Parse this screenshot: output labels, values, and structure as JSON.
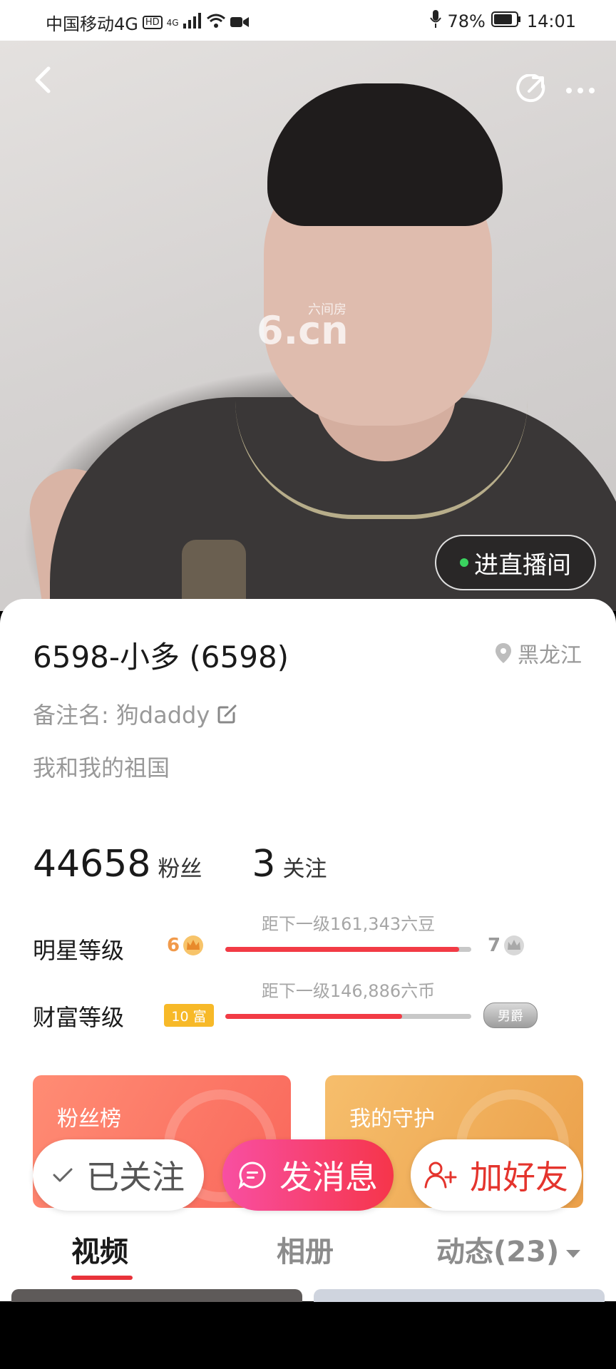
{
  "status_bar": {
    "carrier": "中国移动4G",
    "hd_badge": "HD",
    "net": "4G",
    "battery": "78%",
    "time": "14:01"
  },
  "header": {
    "back_icon": "back-arrow-icon",
    "share_icon": "share-icon",
    "more_icon": "more-dots-icon"
  },
  "hero": {
    "watermark_text": "6.cn",
    "watermark_small": "六间房",
    "live_button": "进直播间"
  },
  "profile": {
    "name": "6598-小多 (6598)",
    "location": "黑龙江",
    "remark_label": "备注名:",
    "remark_value": "狗daddy",
    "signature": "我和我的祖国"
  },
  "stats": {
    "fans_count": "44658",
    "fans_label": "粉丝",
    "following_count": "3",
    "following_label": "关注"
  },
  "levels": {
    "star": {
      "title": "明星等级",
      "current": "6",
      "next": "7",
      "hint": "距下一级161,343六豆",
      "progress": 0.95
    },
    "wealth": {
      "title": "财富等级",
      "current": "10 富",
      "next": "男爵",
      "hint": "距下一级146,886六币",
      "progress": 0.72
    }
  },
  "panels": {
    "fans_title": "粉丝榜",
    "guard_title": "我的守护"
  },
  "actions": {
    "follow": "已关注",
    "message": "发消息",
    "add_friend": "加好友"
  },
  "tabs": [
    {
      "label": "视频"
    },
    {
      "label": "相册"
    },
    {
      "label": "动态(23)"
    }
  ],
  "colors": {
    "accent_red": "#f23b45",
    "live_dot": "#3ad35f",
    "star_level": "#f19a4b",
    "wealth_badge": "#f7b928"
  }
}
